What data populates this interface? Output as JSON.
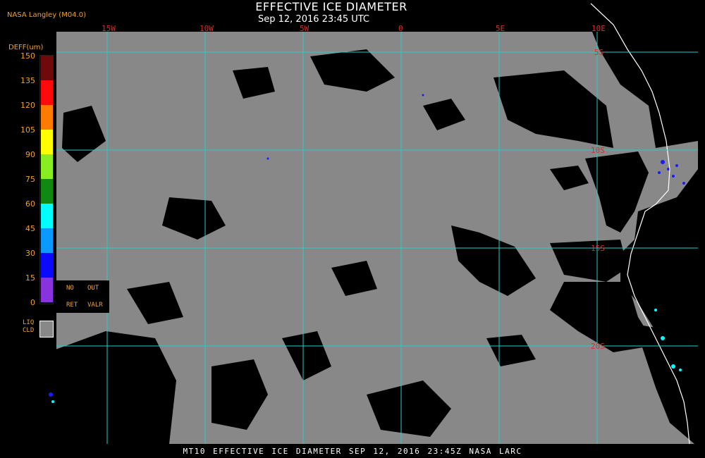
{
  "header": {
    "credit": "NASA Langley (M04.0)",
    "title": "EFFECTIVE ICE DIAMETER",
    "subtitle": "Sep 12, 2016 23:45 UTC"
  },
  "legend": {
    "title": "DEFF(um)",
    "ticks": [
      "150",
      "135",
      "120",
      "105",
      "90",
      "75",
      "60",
      "45",
      "30",
      "15",
      "0"
    ],
    "colors": [
      "#6e0a0a",
      "#ff0a0a",
      "#ff7a00",
      "#ffff00",
      "#88ee22",
      "#118811",
      "#00ffff",
      "#0a99ff",
      "#0a0aff",
      "#8833dd"
    ],
    "no_ret_1": "NO",
    "no_ret_2": "RET",
    "out_valr_1": "OUT",
    "out_valr_2": "VALR",
    "liq_1": "LIQ",
    "liq_2": "CLD",
    "liq_color": "#888888"
  },
  "grid": {
    "lon_labels": [
      "15W",
      "10W",
      "5W",
      "0",
      "5E",
      "10E"
    ],
    "lat_labels": [
      "5S",
      "10S",
      "15S",
      "20S"
    ],
    "grid_color": "#22cccc",
    "coast_color": "#ffffff"
  },
  "map_colors": {
    "background": "#000000",
    "cloud": "#888888",
    "ice_small": "#1a1aff",
    "ice_medium": "#00ffff"
  },
  "footer": {
    "text": "MT10  EFFECTIVE ICE DIAMETER  SEP 12, 2016 23:45Z  NASA LARC"
  }
}
